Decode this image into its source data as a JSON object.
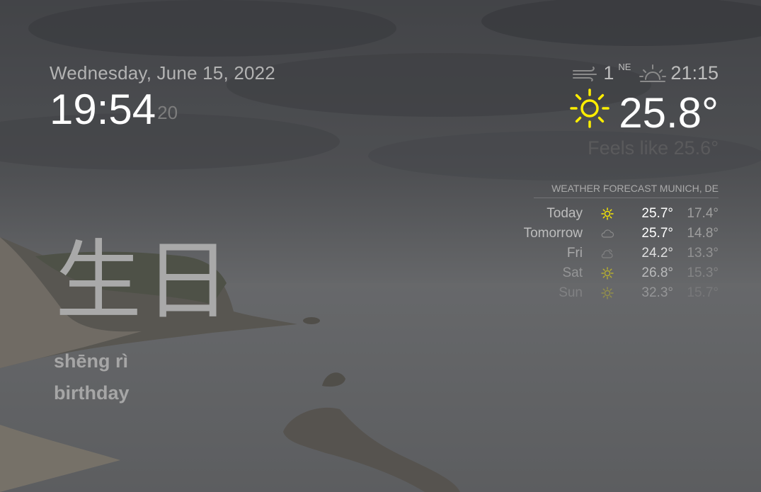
{
  "clock": {
    "date": "Wednesday, June 15, 2022",
    "time": "19:54",
    "seconds": "20"
  },
  "word_of_day": {
    "characters": "生日",
    "pinyin": "shēng rì",
    "meaning": "birthday"
  },
  "current_weather": {
    "wind_speed": "1",
    "wind_direction": "NE",
    "sunset_time": "21:15",
    "temperature": "25.8°",
    "feels_like": "Feels like 25.6°",
    "icon": "sun-icon"
  },
  "forecast": {
    "header": "WEATHER FORECAST MUNICH, DE",
    "days": [
      {
        "day": "Today",
        "icon": "sun-icon",
        "max": "25.7°",
        "min": "17.4°",
        "opacity": 1
      },
      {
        "day": "Tomorrow",
        "icon": "cloud-icon",
        "max": "25.7°",
        "min": "14.8°",
        "opacity": 1
      },
      {
        "day": "Fri",
        "icon": "cloud-sun-icon",
        "max": "24.2°",
        "min": "13.3°",
        "opacity": 0.8
      },
      {
        "day": "Sat",
        "icon": "sun-icon",
        "max": "26.8°",
        "min": "15.3°",
        "opacity": 0.55
      },
      {
        "day": "Sun",
        "icon": "sun-icon",
        "max": "32.3°",
        "min": "15.7°",
        "opacity": 0.3
      }
    ]
  },
  "colors": {
    "sun_yellow": "#ffee00",
    "icon_grey": "#8a8a8a"
  }
}
